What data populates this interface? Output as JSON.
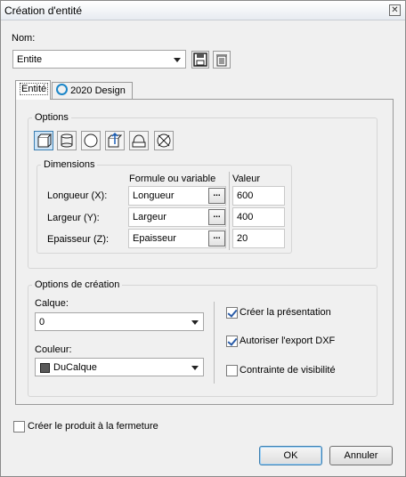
{
  "window": {
    "title": "Création d'entité",
    "close_glyph": "✕"
  },
  "name_section": {
    "label": "Nom:",
    "value": "Entite"
  },
  "tabs": [
    {
      "label": "Entité"
    },
    {
      "label": "2020 Design"
    }
  ],
  "options": {
    "title": "Options",
    "shape_buttons": [
      "box-shape-icon",
      "cylinder-shape-icon",
      "sphere-shape-icon",
      "extrude-shape-icon",
      "revolve-shape-icon",
      "none-shape-icon"
    ]
  },
  "dimensions": {
    "title": "Dimensions",
    "col_formula": "Formule ou variable",
    "col_value": "Valeur",
    "rows": [
      {
        "label": "Longueur (X):",
        "formula": "Longueur",
        "value": "600"
      },
      {
        "label": "Largeur (Y):",
        "formula": "Largeur",
        "value": "400"
      },
      {
        "label": "Epaisseur (Z):",
        "formula": "Epaisseur",
        "value": "20"
      }
    ],
    "dots_label": "..."
  },
  "creation_options": {
    "title": "Options de création",
    "layer_label": "Calque:",
    "layer_value": "0",
    "color_label": "Couleur:",
    "color_value": "DuCalque",
    "checkboxes": [
      {
        "label": "Créer la présentation",
        "checked": true
      },
      {
        "label": "Autoriser l'export DXF",
        "checked": true
      },
      {
        "label": "Contrainte de visibilité",
        "checked": false
      }
    ]
  },
  "footer": {
    "create_on_close": "Créer le produit à la fermeture",
    "ok": "OK",
    "cancel": "Annuler"
  }
}
